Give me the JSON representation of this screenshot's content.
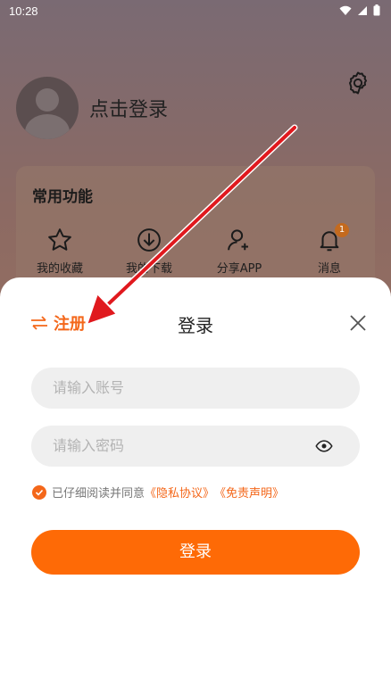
{
  "status_bar": {
    "time": "10:28"
  },
  "profile": {
    "login_prompt": "点击登录"
  },
  "functions": {
    "title": "常用功能",
    "items": [
      {
        "label": "我的收藏",
        "icon": "star-icon"
      },
      {
        "label": "我的下载",
        "icon": "download-icon"
      },
      {
        "label": "分享APP",
        "icon": "share-user-icon"
      },
      {
        "label": "消息",
        "icon": "bell-icon",
        "badge": "1"
      }
    ]
  },
  "sheet": {
    "register_label": "注册",
    "title": "登录",
    "account_placeholder": "请输入账号",
    "password_placeholder": "请输入密码",
    "agree_text": "已仔细阅读并同意",
    "privacy_link": "《隐私协议》",
    "disclaimer_link": "《免责声明》",
    "login_button": "登录"
  },
  "colors": {
    "accent": "#fe6a06",
    "annotation_arrow": "#e0191e"
  }
}
